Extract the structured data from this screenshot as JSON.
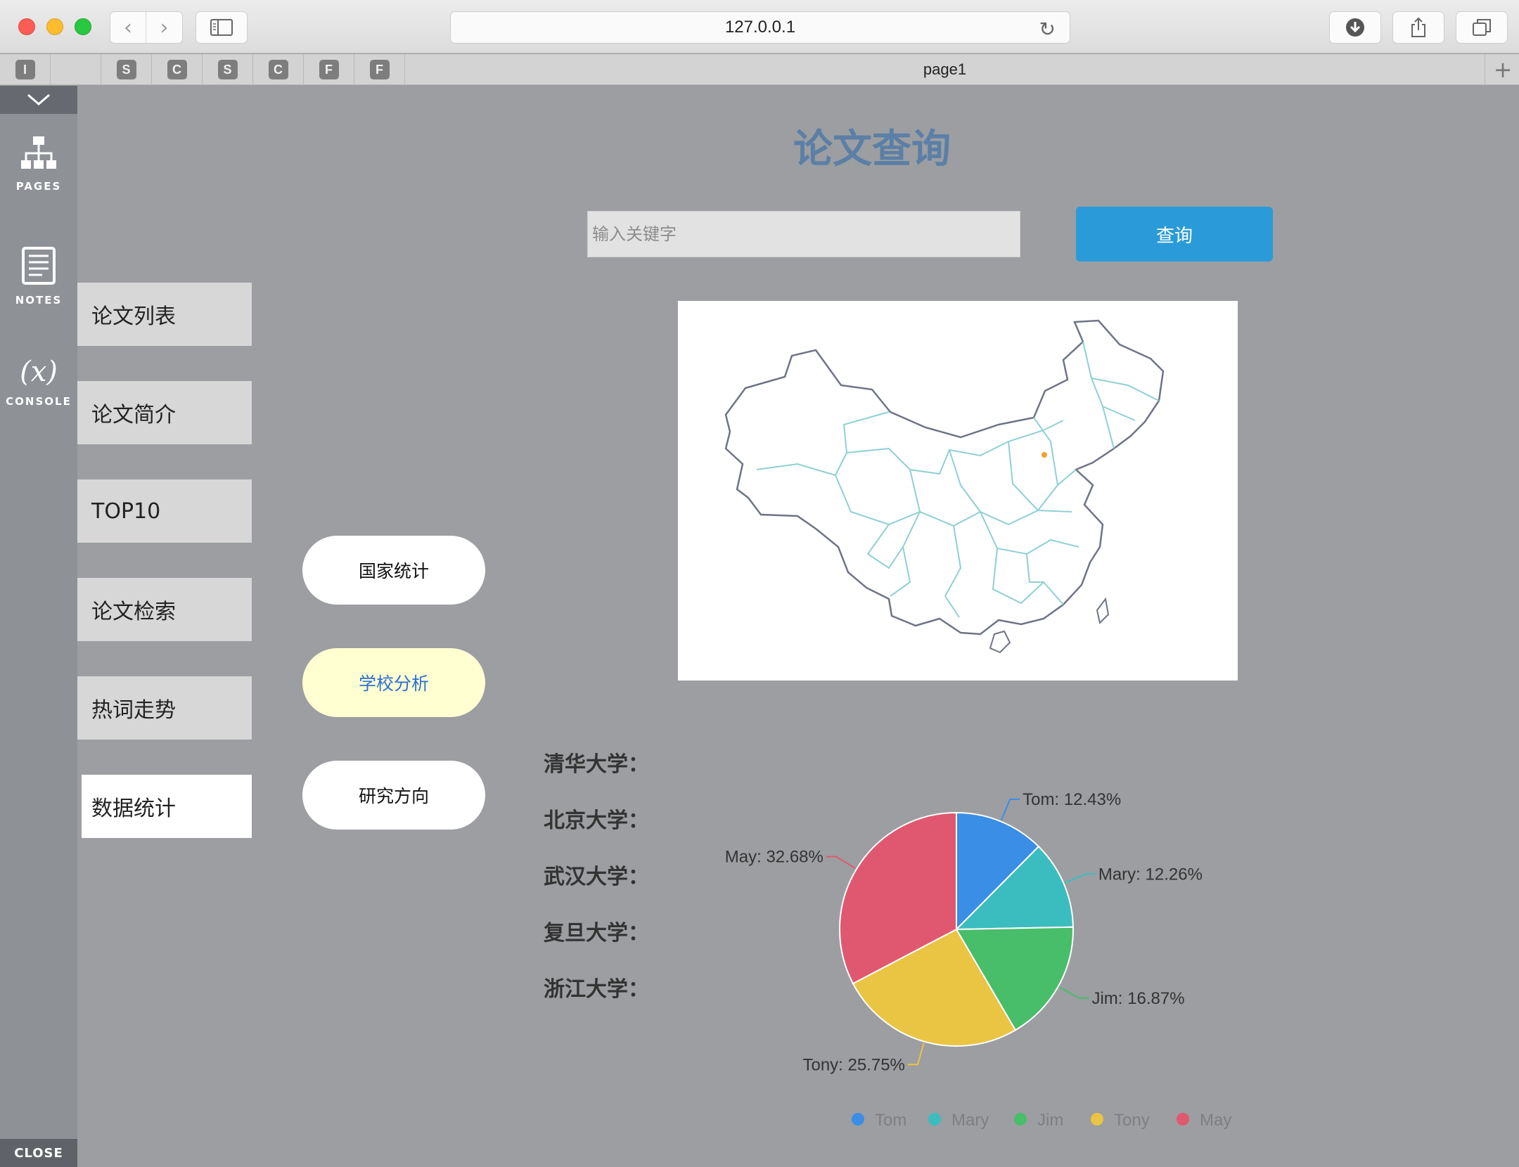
{
  "browser": {
    "url": "127.0.0.1",
    "pinned_tabs": [
      "I",
      "",
      "S",
      "C",
      "S",
      "C",
      "F",
      "F"
    ],
    "active_tab": "page1",
    "new_tab": "+"
  },
  "tools": {
    "pages": "PAGES",
    "notes": "NOTES",
    "console_glyph": "(x)",
    "console": "CONSOLE",
    "close": "CLOSE"
  },
  "page": {
    "title": "论文查询",
    "search_placeholder": "输入关键字",
    "query_button": "查询",
    "menu": [
      "论文列表",
      "论文简介",
      "TOP10",
      "论文检索",
      "热词走势",
      "数据统计"
    ],
    "active_menu": 5,
    "pills": [
      "国家统计",
      "学校分析",
      "研究方向"
    ],
    "selected_pill": 1,
    "universities": [
      "清华大学：",
      "北京大学：",
      "武汉大学：",
      "复旦大学：",
      "浙江大学："
    ]
  },
  "chart_data": {
    "type": "pie",
    "series": [
      {
        "name": "Tom",
        "value": 12.43,
        "color": "#3a8ee6"
      },
      {
        "name": "Mary",
        "value": 12.26,
        "color": "#3bbdbf"
      },
      {
        "name": "Jim",
        "value": 16.87,
        "color": "#48bd6a"
      },
      {
        "name": "Tony",
        "value": 25.75,
        "color": "#eac443"
      },
      {
        "name": "May",
        "value": 32.68,
        "color": "#e05870"
      }
    ],
    "labels": [
      "Tom: 12.43%",
      "Mary: 12.26%",
      "Jim: 16.87%",
      "Tony: 25.75%",
      "May: 32.68%"
    ],
    "legend_position": "bottom"
  }
}
